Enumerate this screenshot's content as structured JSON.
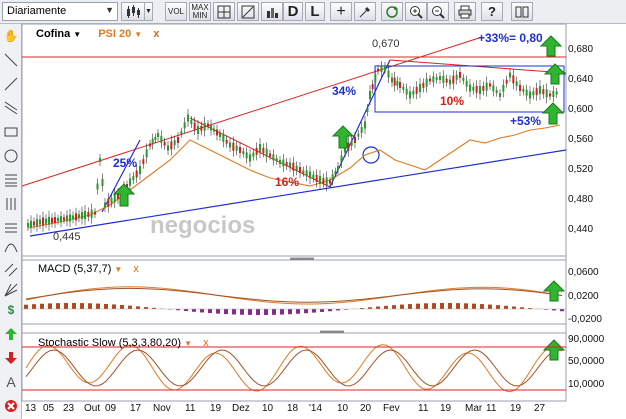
{
  "toolbar": {
    "period": "Diariamente",
    "vol": "VOL",
    "maxmin_top": "MAX",
    "maxmin_bottom": "MIN",
    "d_label": "D",
    "l_label": "L"
  },
  "main_legend": {
    "symbol": "Cofina",
    "compare": "PSI 20",
    "close": "x"
  },
  "macd_legend": {
    "label": "MACD (5,37,7)",
    "close": "x"
  },
  "stoch_legend": {
    "label": "Stochastic Slow (5,3,3,80,20)",
    "close": "x"
  },
  "annotations": {
    "high": "0,670",
    "low": "0,445",
    "p25": "25%",
    "p34": "34%",
    "p16": "16%",
    "p10": "10%",
    "p33": "+33%= 0,80",
    "p53": "+53%",
    "watermark": "negocios"
  },
  "main_yaxis": [
    "0,680",
    "0,640",
    "0,600",
    "0,560",
    "0,520",
    "0,480",
    "0,440"
  ],
  "macd_yaxis": [
    "0,0600",
    "0,0200",
    "-0,0200"
  ],
  "stoch_yaxis": [
    "90,0000",
    "50,0000",
    "10,0000"
  ],
  "xaxis": [
    "13",
    "05",
    "23",
    "Out",
    "09",
    "17",
    "Nov",
    "11",
    "19",
    "Dez",
    "10",
    "18",
    "'14",
    "10",
    "20",
    "Fev",
    "11",
    "19",
    "Mar",
    "11",
    "19",
    "27"
  ],
  "colors": {
    "price_up": "#2a9a2a",
    "price_down": "#d02020",
    "psi": "#e07b20",
    "trend_blue": "#1f2fd0",
    "trend_red": "#e02020",
    "accent_green": "#2fb52f",
    "blue_text": "#1f2fd0",
    "red_text": "#d02020"
  }
}
